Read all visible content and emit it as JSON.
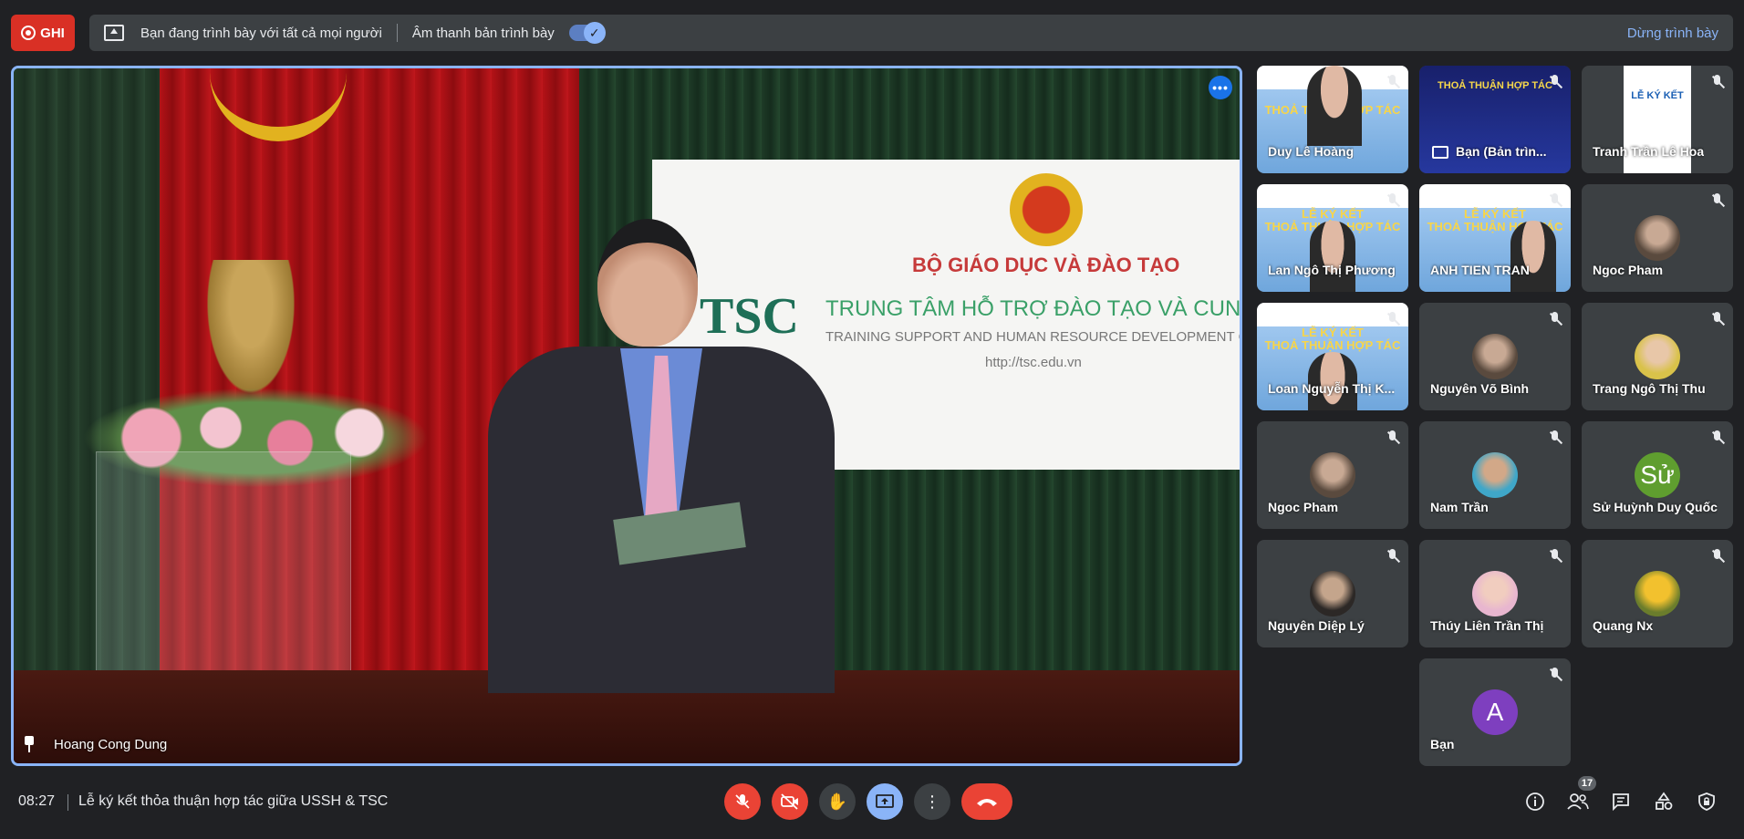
{
  "top_bar": {
    "record_label": "GHI",
    "presenting_text": "Bạn đang trình bày với tất cả mọi người",
    "audio_label": "Âm thanh bản trình bày",
    "audio_toggle_on": true,
    "stop_label": "Dừng trình bày"
  },
  "main_video": {
    "name": "Hoang Cong Dung",
    "banner_line1": "BỘ GIÁO DỤC VÀ ĐÀO TẠO",
    "banner_logo": "TSC",
    "banner_line2": "TRUNG TÂM HỖ TRỢ ĐÀO TẠO VÀ CUNG ỨNG NHÂN L",
    "banner_line3": "TRAINING SUPPORT AND HUMAN RESOURCE DEVELOPMENT CENT",
    "banner_url": "http://tsc.edu.vn"
  },
  "tiles": [
    {
      "name": "Duy Lê Hoàng"
    },
    {
      "name": "Bạn (Bản trìn..."
    },
    {
      "name": "Tranh Trần Lê Hoa"
    },
    {
      "name": "Lan Ngô Thị Phương"
    },
    {
      "name": "ANH TIEN TRAN"
    },
    {
      "name": "Ngoc Pham"
    },
    {
      "name": "Loan Nguyễn Thị K..."
    },
    {
      "name": "Nguyên Võ Bình"
    },
    {
      "name": "Trang Ngô Thị Thu"
    },
    {
      "name": "Ngoc Pham"
    },
    {
      "name": "Nam Trần"
    },
    {
      "name": "Sử Huỳnh Duy Quốc",
      "letter": "Sử",
      "color": "#5f9e2f"
    },
    {
      "name": "Nguyên Diệp Lý"
    },
    {
      "name": "Thúy Liên Trần Thị"
    },
    {
      "name": "Quang Nx"
    },
    {
      "name": "Bạn",
      "letter": "A",
      "color": "#7e3fbf"
    }
  ],
  "tsc_slide": {
    "line1": "LỄ KÝ KẾT",
    "line2": "THOẢ THUẬN HỢP TÁC"
  },
  "bottom_bar": {
    "time": "08:27",
    "meeting_title": "Lễ ký kết thỏa thuận hợp tác giữa USSH & TSC",
    "participant_count": "17"
  },
  "colors": {
    "accent": "#8ab4f8",
    "danger": "#ea4335",
    "tile_bg": "#3c4043"
  }
}
